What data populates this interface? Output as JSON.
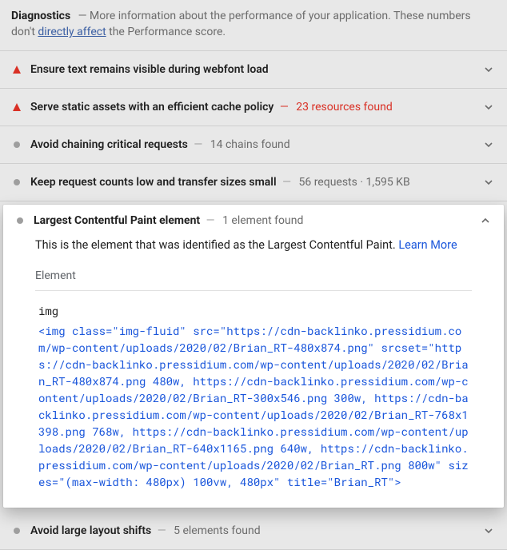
{
  "header": {
    "title": "Diagnostics",
    "desc_prefix": "— More information about the performance of your application. These numbers don't ",
    "desc_link": "directly affect",
    "desc_suffix": " the Performance score."
  },
  "audits": [
    {
      "icon": "triangle",
      "title": "Ensure text remains visible during webfont load",
      "extra": "",
      "red": false
    },
    {
      "icon": "triangle",
      "title": "Serve static assets with an efficient cache policy",
      "extra": "23 resources found",
      "red": true
    },
    {
      "icon": "neutral",
      "title": "Avoid chaining critical requests",
      "extra": "14 chains found",
      "red": false
    },
    {
      "icon": "neutral",
      "title": "Keep request counts low and transfer sizes small",
      "extra": "56 requests · 1,595 KB",
      "red": false
    }
  ],
  "expanded": {
    "icon": "neutral",
    "title": "Largest Contentful Paint element",
    "extra": "1 element found",
    "desc": "This is the element that was identified as the Largest Contentful Paint. ",
    "learn_more": "Learn More",
    "element_heading": "Element",
    "code_tag": "img",
    "code_html": "<img class=\"img-fluid\" src=\"https://cdn-backlinko.pressidium.com/wp-content/uploads/2020/02/Brian_RT-480x874.png\" srcset=\"https://cdn-backlinko.pressidium.com/wp-content/uploads/2020/02/Brian_RT-480x874.png 480w, https://cdn-backlinko.pressidium.com/wp-content/uploads/2020/02/Brian_RT-300x546.png 300w, https://cdn-backlinko.pressidium.com/wp-content/uploads/2020/02/Brian_RT-768x1398.png 768w, https://cdn-backlinko.pressidium.com/wp-content/uploads/2020/02/Brian_RT-640x1165.png 640w, https://cdn-backlinko.pressidium.com/wp-content/uploads/2020/02/Brian_RT.png 800w\" sizes=\"(max-width: 480px) 100vw, 480px\" title=\"Brian_RT\">"
  },
  "after": [
    {
      "icon": "neutral",
      "title": "Avoid large layout shifts",
      "extra": "5 elements found",
      "red": false
    }
  ]
}
